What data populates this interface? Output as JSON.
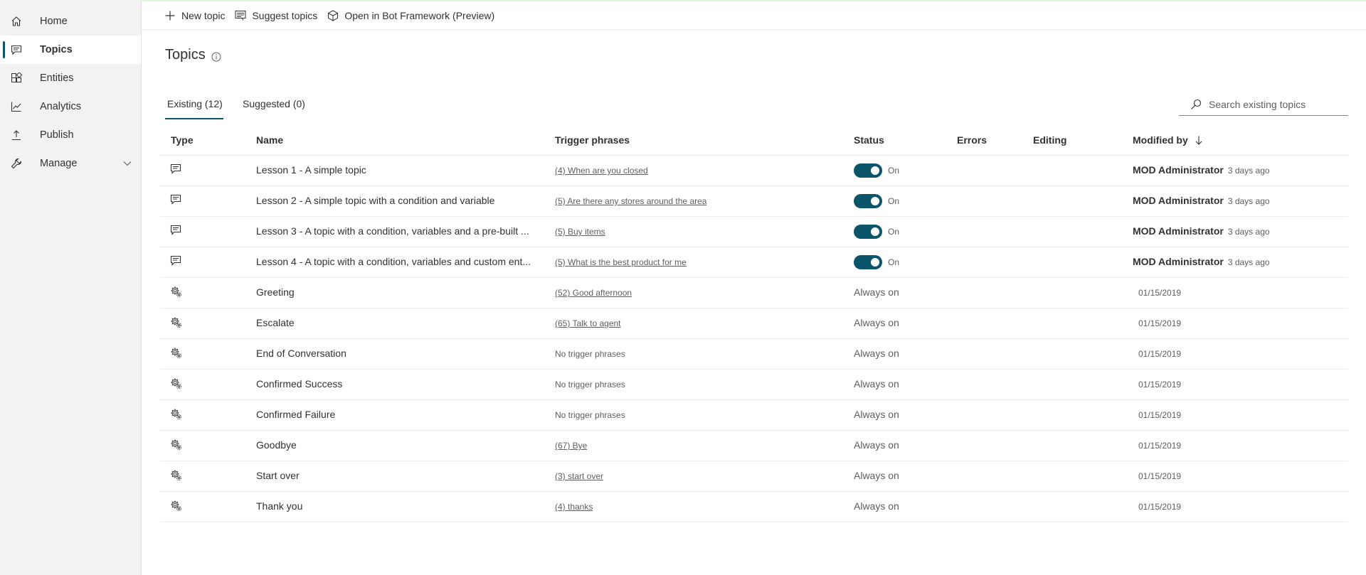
{
  "sidebar": {
    "items": [
      {
        "label": "Home",
        "icon": "home-icon"
      },
      {
        "label": "Topics",
        "icon": "chat-icon",
        "active": true
      },
      {
        "label": "Entities",
        "icon": "entities-icon"
      },
      {
        "label": "Analytics",
        "icon": "analytics-icon"
      },
      {
        "label": "Publish",
        "icon": "publish-icon"
      },
      {
        "label": "Manage",
        "icon": "manage-icon"
      }
    ]
  },
  "toolbar": {
    "new_topic": "New topic",
    "suggest_topics": "Suggest topics",
    "open_bot_framework": "Open in Bot Framework (Preview)"
  },
  "header": {
    "title": "Topics"
  },
  "tabs": {
    "existing": "Existing (12)",
    "suggested": "Suggested (0)"
  },
  "search": {
    "placeholder": "Search existing topics"
  },
  "table": {
    "columns": {
      "type": "Type",
      "name": "Name",
      "trigger": "Trigger phrases",
      "status": "Status",
      "errors": "Errors",
      "editing": "Editing",
      "modified": "Modified by"
    },
    "rows": [
      {
        "type": "custom",
        "name": "Lesson 1 - A simple topic",
        "trigger": "(4) When are you closed",
        "status": "On",
        "modified_by": "MOD Administrator",
        "modified": "3 days ago"
      },
      {
        "type": "custom",
        "name": "Lesson 2 - A simple topic with a condition and variable",
        "trigger": "(5) Are there any stores around the area",
        "status": "On",
        "modified_by": "MOD Administrator",
        "modified": "3 days ago"
      },
      {
        "type": "custom",
        "name": "Lesson 3 - A topic with a condition, variables and a pre-built ...",
        "trigger": "(5) Buy items",
        "status": "On",
        "modified_by": "MOD Administrator",
        "modified": "3 days ago"
      },
      {
        "type": "custom",
        "name": "Lesson 4 - A topic with a condition, variables and custom ent...",
        "trigger": "(5) What is the best product for me",
        "status": "On",
        "modified_by": "MOD Administrator",
        "modified": "3 days ago"
      },
      {
        "type": "system",
        "name": "Greeting",
        "trigger": "(52) Good afternoon",
        "status": "Always on",
        "modified": "01/15/2019"
      },
      {
        "type": "system",
        "name": "Escalate",
        "trigger": "(65) Talk to agent",
        "status": "Always on",
        "modified": "01/15/2019"
      },
      {
        "type": "system",
        "name": "End of Conversation",
        "trigger": "No trigger phrases",
        "status": "Always on",
        "modified": "01/15/2019"
      },
      {
        "type": "system",
        "name": "Confirmed Success",
        "trigger": "No trigger phrases",
        "status": "Always on",
        "modified": "01/15/2019"
      },
      {
        "type": "system",
        "name": "Confirmed Failure",
        "trigger": "No trigger phrases",
        "status": "Always on",
        "modified": "01/15/2019"
      },
      {
        "type": "system",
        "name": "Goodbye",
        "trigger": "(67) Bye",
        "status": "Always on",
        "modified": "01/15/2019"
      },
      {
        "type": "system",
        "name": "Start over",
        "trigger": "(3) start over",
        "status": "Always on",
        "modified": "01/15/2019"
      },
      {
        "type": "system",
        "name": "Thank you",
        "trigger": "(4) thanks",
        "status": "Always on",
        "modified": "01/15/2019"
      }
    ]
  },
  "colors": {
    "accent": "#0b556a",
    "sidebar_bg": "#f3f2f1"
  }
}
